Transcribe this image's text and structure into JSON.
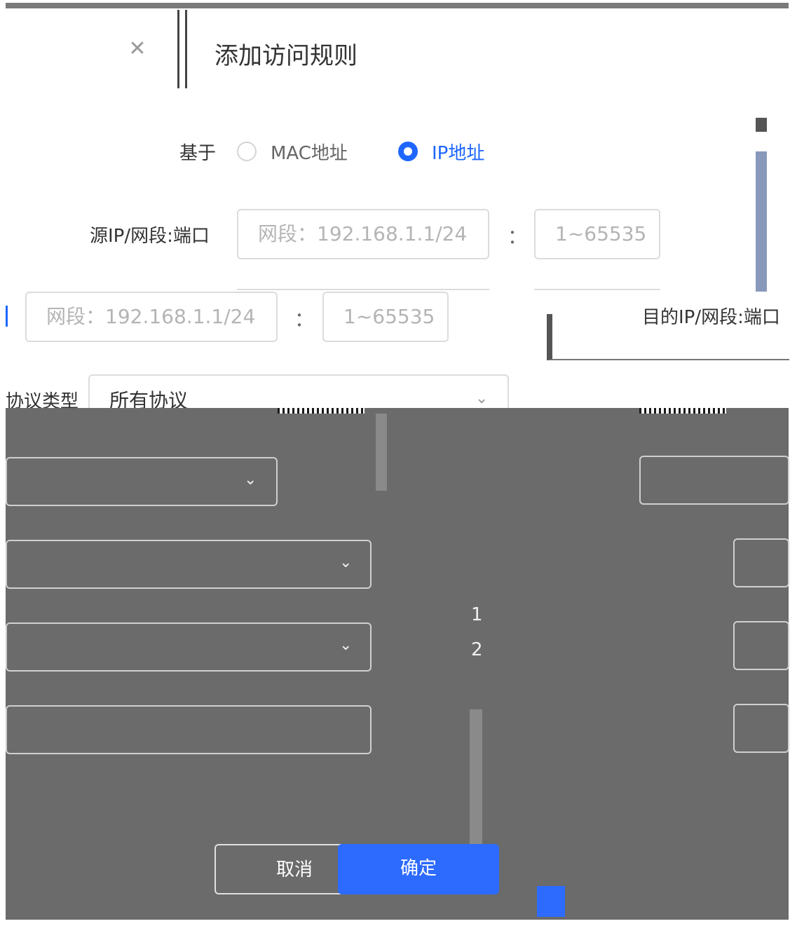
{
  "dialog": {
    "title": "添加访问规则"
  },
  "based_on": {
    "label": "基于",
    "options": [
      "MAC地址",
      "IP地址"
    ],
    "selected": "IP地址"
  },
  "source": {
    "label": "源IP/网段:端口",
    "ip_placeholder": "网段：192.168.1.1/24",
    "port_placeholder": "1~65535",
    "colon": "："
  },
  "destination": {
    "label": "目的IP/网段:端口",
    "ip_placeholder": "网段：192.168.1.1/24",
    "port_placeholder": "1~65535",
    "colon": "："
  },
  "protocol": {
    "label": "协议类型",
    "value": "所有协议"
  },
  "overlay_numbers": [
    "1",
    "2"
  ],
  "colors": {
    "accent": "#2d6bff",
    "radio_selected": "#1e66ff",
    "overlay": "#6b6b6b"
  },
  "icons": {
    "close": "close-icon",
    "chevron": "chevron-down-icon"
  },
  "buttons": {
    "cancel": "取消",
    "ok": "确定"
  }
}
